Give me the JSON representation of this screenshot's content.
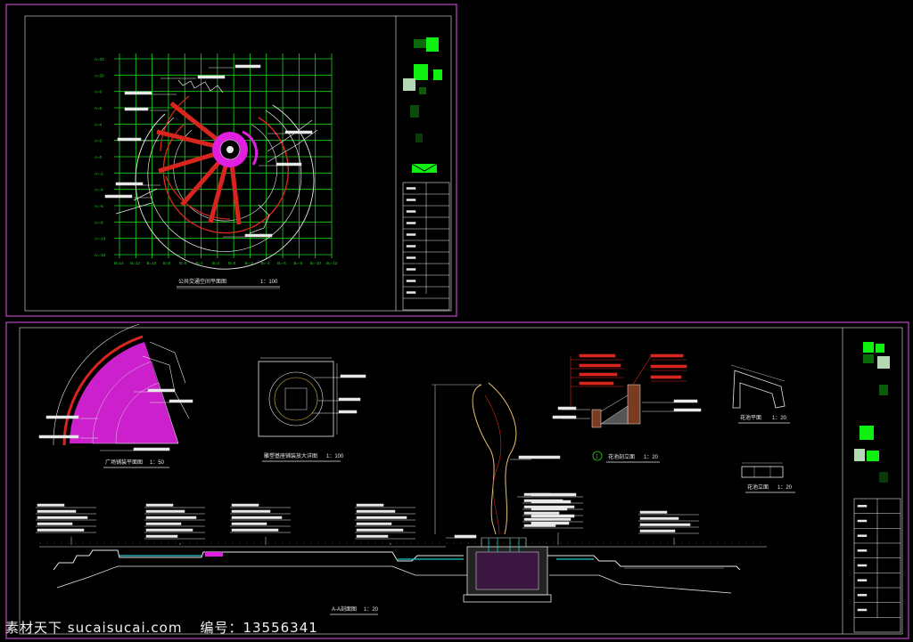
{
  "colors": {
    "background": "#000000",
    "frame": "#b040b0",
    "grid": "#1fd31f",
    "plaza_red": "#d8261e",
    "plaza_magenta": "#e020e0",
    "linework": "#e8e8e8",
    "contour": "#e8c070",
    "water": "#20c8d0",
    "title_block_green": "#10f010"
  },
  "top_sheet": {
    "grid_rows": [
      "A=33",
      "A=30",
      "A=6",
      "A=6",
      "A=4",
      "A=2",
      "A=0",
      "A=-2",
      "A=-4",
      "A=-6",
      "A=-8",
      "A=-10",
      "A=-33"
    ],
    "grid_cols": [
      "B=14",
      "B=12",
      "B=10",
      "B=8",
      "B=6",
      "B=4",
      "B=2",
      "B=0",
      "B=-2",
      "B=-4",
      "B=-6",
      "B=-8",
      "B=-10",
      "B=-13"
    ],
    "plan_title": "公共交通空间平面图",
    "plan_scale": "1：100",
    "title_block_rows": [
      "",
      "",
      "",
      "",
      "",
      "",
      "",
      "",
      "",
      "",
      ""
    ]
  },
  "bottom_sheet": {
    "sector_title": "广场铺装平面图",
    "sector_scale": "1：50",
    "detail_title": "雕塑基座铺装放大详图",
    "detail_scale": "1：100",
    "planter_section_title": "花池剖立面",
    "planter_section_scale": "1：20",
    "planter_plan_title": "花池平面",
    "planter_plan_scale": "1：20",
    "planter_elev_title": "花池立面",
    "planter_elev_scale": "1：20",
    "section_title": "A-A剖面图",
    "section_scale": "1：20",
    "callout_marker": "1"
  },
  "watermark": {
    "site": "素材天下 sucaisucai.com",
    "id_label": "编号：13556341"
  }
}
